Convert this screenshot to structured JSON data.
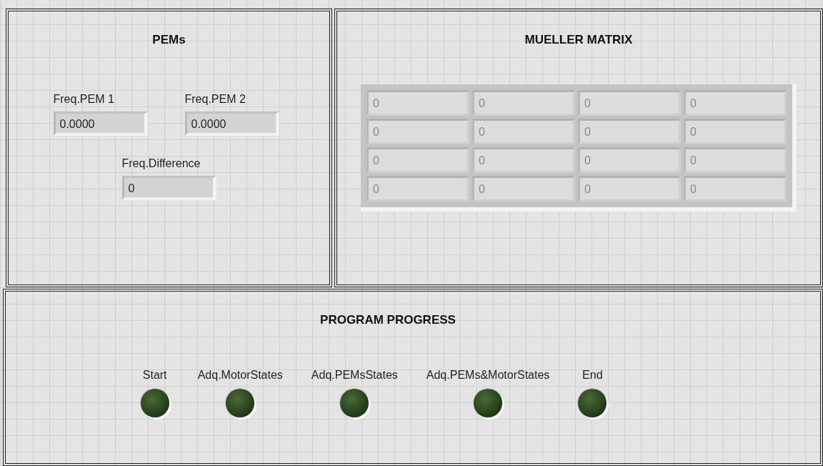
{
  "pems": {
    "title": "PEMs",
    "fields": [
      {
        "label": "Freq.PEM 1",
        "value": "0.0000"
      },
      {
        "label": "Freq.PEM 2",
        "value": "0.0000"
      },
      {
        "label": "Freq.Difference",
        "value": "0"
      }
    ]
  },
  "mueller_matrix": {
    "title": "MUELLER MATRIX",
    "rows": [
      [
        "0",
        "0",
        "0",
        "0"
      ],
      [
        "0",
        "0",
        "0",
        "0"
      ],
      [
        "0",
        "0",
        "0",
        "0"
      ],
      [
        "0",
        "0",
        "0",
        "0"
      ]
    ]
  },
  "program_progress": {
    "title": "PROGRAM PROGRESS",
    "indicators": [
      {
        "label": "Start",
        "on": false
      },
      {
        "label": "Adq.MotorStates",
        "on": false
      },
      {
        "label": "Adq.PEMsStates",
        "on": false
      },
      {
        "label": "Adq.PEMs&MotorStates",
        "on": false
      },
      {
        "label": "End",
        "on": false
      }
    ]
  }
}
